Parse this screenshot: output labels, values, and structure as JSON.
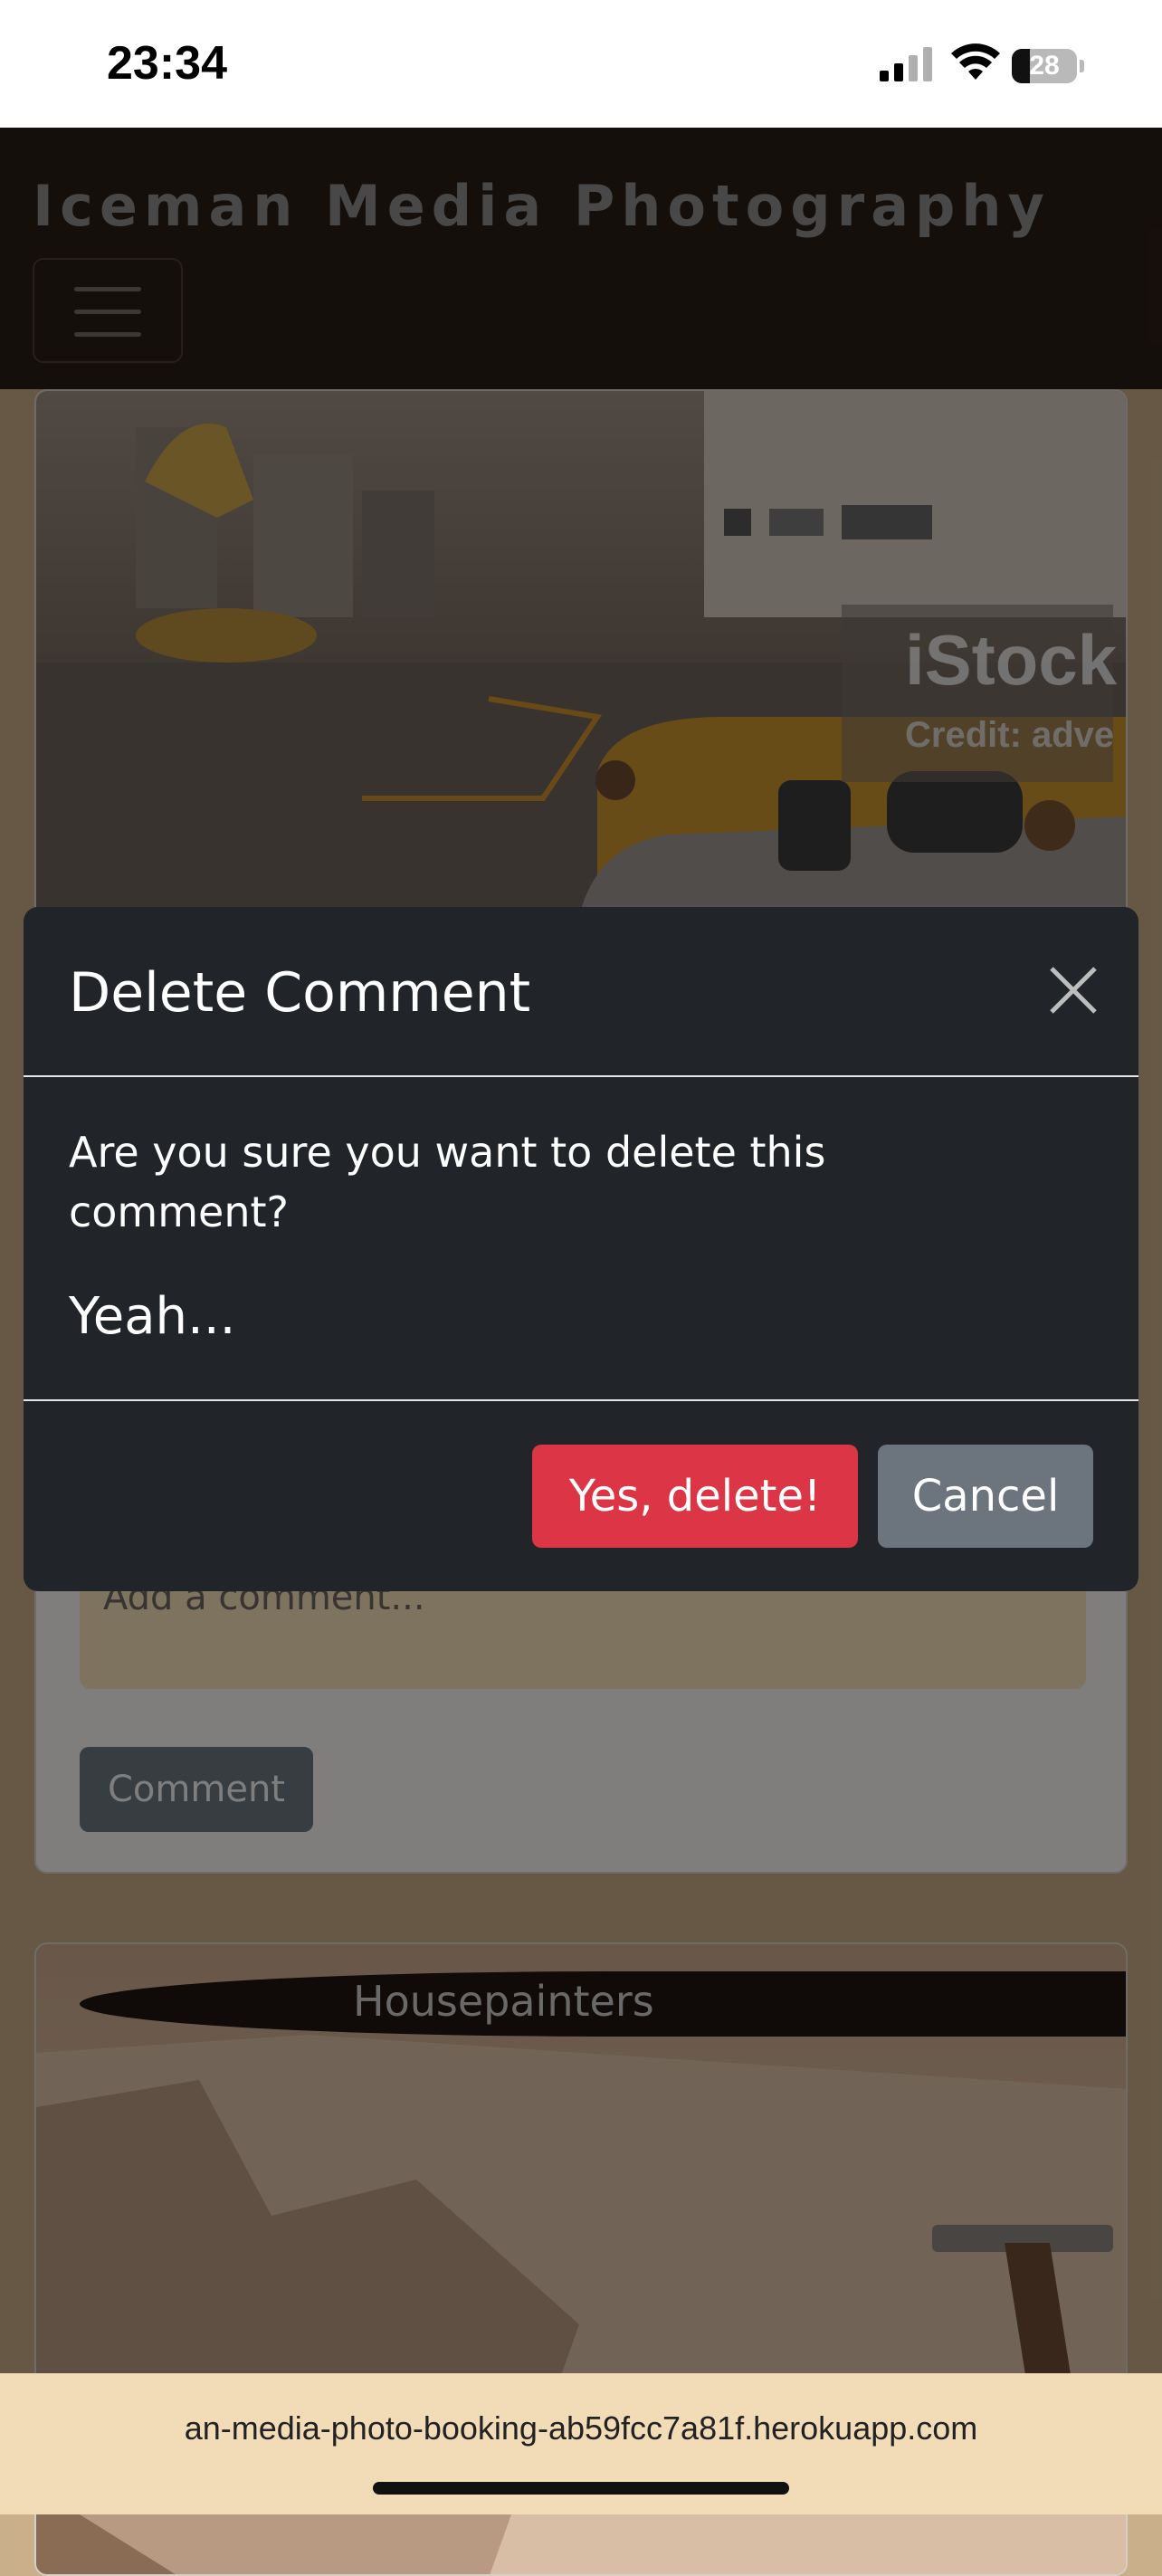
{
  "status_bar": {
    "time": "23:34",
    "battery_level": "28",
    "battery_fraction": 0.28
  },
  "navbar": {
    "brand": "Iceman Media Photography",
    "menu_icon": "hamburger-menu-icon"
  },
  "post1": {
    "watermark_brand": "iStock",
    "watermark_credit": "Credit: adve",
    "comment_placeholder": "Add a comment...",
    "comment_button_label": "Comment"
  },
  "post2": {
    "title": "Housepainters"
  },
  "modal": {
    "title": "Delete Comment",
    "close_icon": "close-icon",
    "question": "Are you sure you want to delete this comment?",
    "comment_text": "Yeah...",
    "confirm_label": "Yes, delete!",
    "cancel_label": "Cancel",
    "confirm_color": "#dc3545",
    "cancel_color": "#6c757d",
    "background_color": "#212529"
  },
  "browser": {
    "url": "an-media-photo-booking-ab59fcc7a81f.herokuapp.com"
  }
}
